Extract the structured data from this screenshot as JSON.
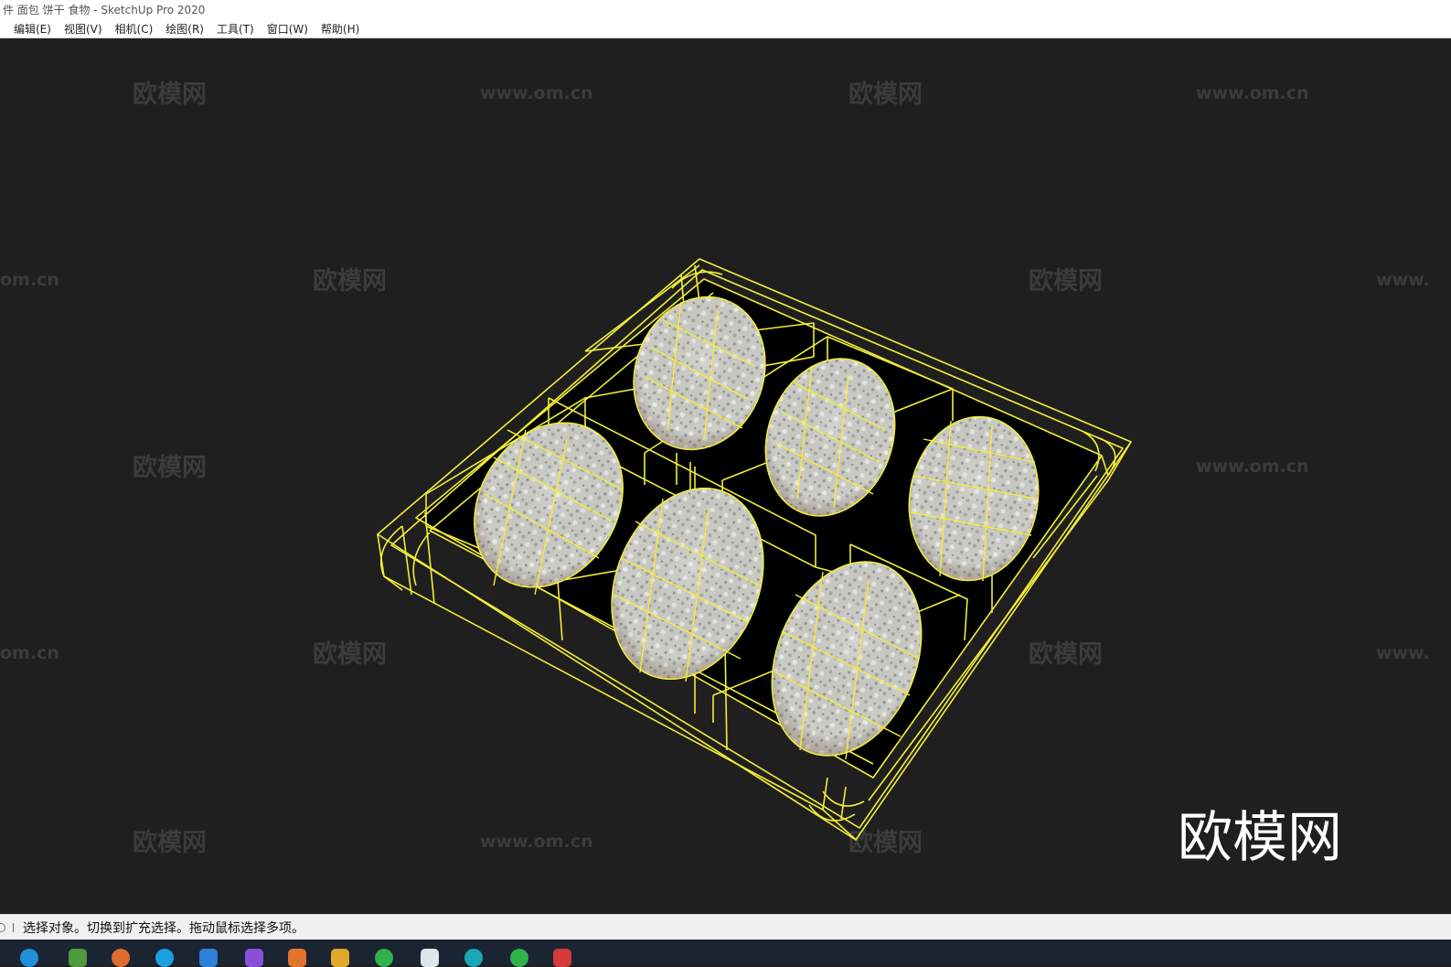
{
  "window": {
    "title": "件 面包 饼干 食物 - SketchUp Pro 2020"
  },
  "menu": [
    {
      "label": "编辑(E)"
    },
    {
      "label": "视图(V)"
    },
    {
      "label": "相机(C)"
    },
    {
      "label": "绘图(R)"
    },
    {
      "label": "工具(T)"
    },
    {
      "label": "窗口(W)"
    },
    {
      "label": "帮助(H)"
    }
  ],
  "watermark": {
    "cn": "欧模网",
    "url": "www.om.cn",
    "url_cut_left": "om.cn",
    "url_cut_right": "www.",
    "corner_logo": "欧模网"
  },
  "statusbar": {
    "message": "选择对象。切换到扩充选择。拖动鼠标选择多项。"
  },
  "colors": {
    "viewport_bg": "#1f1f1f",
    "wireframe": "#f2ee38",
    "food_texture": "#c9c9c4"
  },
  "taskbar": {
    "icons": [
      "browser-icon",
      "app-icon",
      "app-icon",
      "app-icon",
      "app-icon",
      "app-icon",
      "app-icon",
      "app-icon",
      "folder-icon",
      "wechat-icon",
      "app-icon",
      "wechat-icon",
      "app-icon"
    ]
  }
}
